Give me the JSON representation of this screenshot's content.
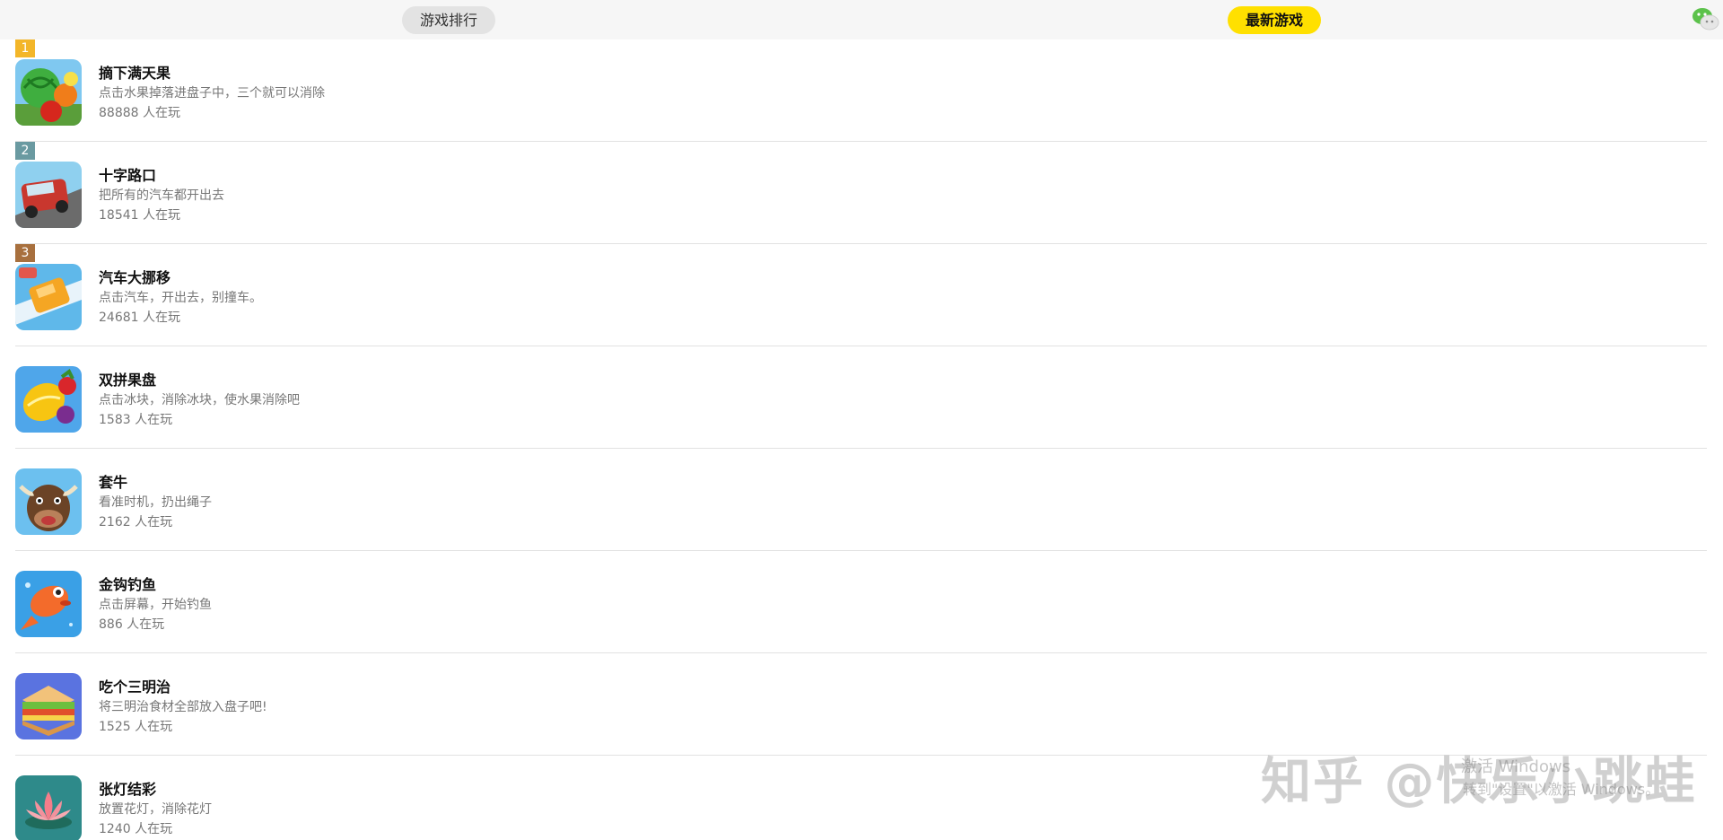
{
  "header": {
    "tab_rank": "游戏排行",
    "tab_new": "最新游戏",
    "wechat_icon": "wechat-icon"
  },
  "games": [
    {
      "rank": "1",
      "rank_color": "#f3b629",
      "title": "摘下满天果",
      "desc": "点击水果掉落进盘子中，三个就可以消除",
      "players": "88888 人在玩",
      "icon": "fruit-icon"
    },
    {
      "rank": "2",
      "rank_color": "#6a9aa1",
      "title": "十字路口",
      "desc": "把所有的汽车都开出去",
      "players": "18541 人在玩",
      "icon": "crossroad-car-icon"
    },
    {
      "rank": "3",
      "rank_color": "#a8703e",
      "title": "汽车大挪移",
      "desc": "点击汽车，开出去，别撞车。",
      "players": "24681 人在玩",
      "icon": "car-move-icon"
    },
    {
      "rank": "",
      "rank_color": "",
      "title": "双拼果盘",
      "desc": "点击冰块，消除冰块，使水果消除吧",
      "players": "1583 人在玩",
      "icon": "fruit-plate-icon"
    },
    {
      "rank": "",
      "rank_color": "",
      "title": "套牛",
      "desc": "看准时机，扔出绳子",
      "players": "2162 人在玩",
      "icon": "bull-icon"
    },
    {
      "rank": "",
      "rank_color": "",
      "title": "金钩钓鱼",
      "desc": "点击屏幕，开始钓鱼",
      "players": "886 人在玩",
      "icon": "fish-icon"
    },
    {
      "rank": "",
      "rank_color": "",
      "title": "吃个三明治",
      "desc": "将三明治食材全部放入盘子吧!",
      "players": "1525 人在玩",
      "icon": "sandwich-icon"
    },
    {
      "rank": "",
      "rank_color": "",
      "title": "张灯结彩",
      "desc": "放置花灯，消除花灯",
      "players": "1240 人在玩",
      "icon": "lotus-lantern-icon"
    }
  ],
  "watermark": {
    "main": "知乎 @快乐小跳蛙",
    "activate_line1": "激活 Windows",
    "activate_line2": "转到\"设置\"以激活 Windows。"
  }
}
